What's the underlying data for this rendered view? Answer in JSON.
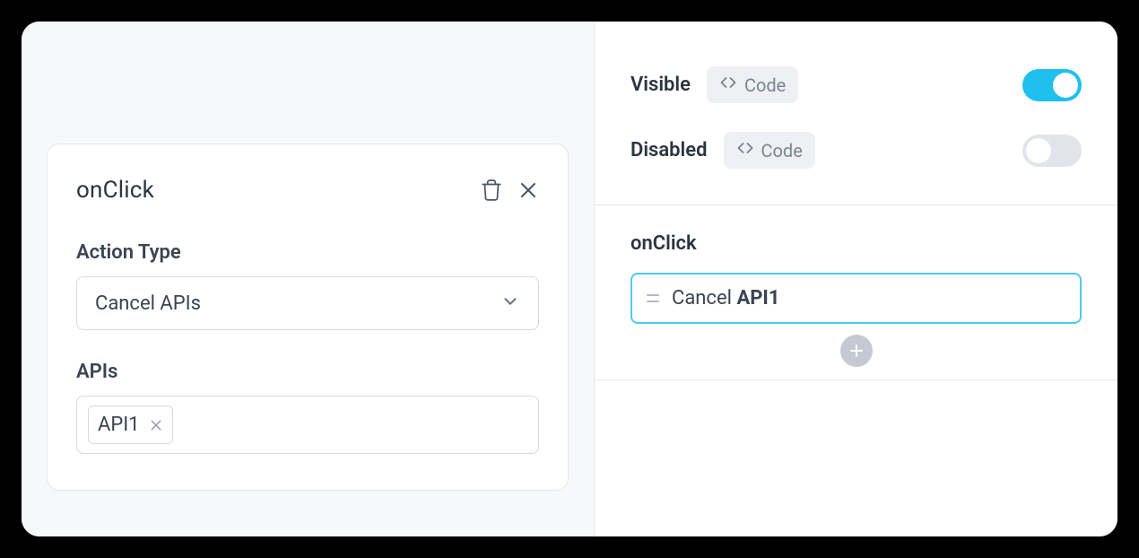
{
  "leftPanel": {
    "card": {
      "title": "onClick",
      "actionTypeLabel": "Action Type",
      "actionTypeValue": "Cancel APIs",
      "apisLabel": "APIs",
      "apiTags": [
        "API1"
      ]
    }
  },
  "rightPanel": {
    "visible": {
      "label": "Visible",
      "codeLabel": "Code",
      "enabled": true
    },
    "disabled": {
      "label": "Disabled",
      "codeLabel": "Code",
      "enabled": false
    },
    "onClick": {
      "label": "onClick",
      "actionPrefix": "Cancel ",
      "actionTarget": "API1"
    }
  }
}
